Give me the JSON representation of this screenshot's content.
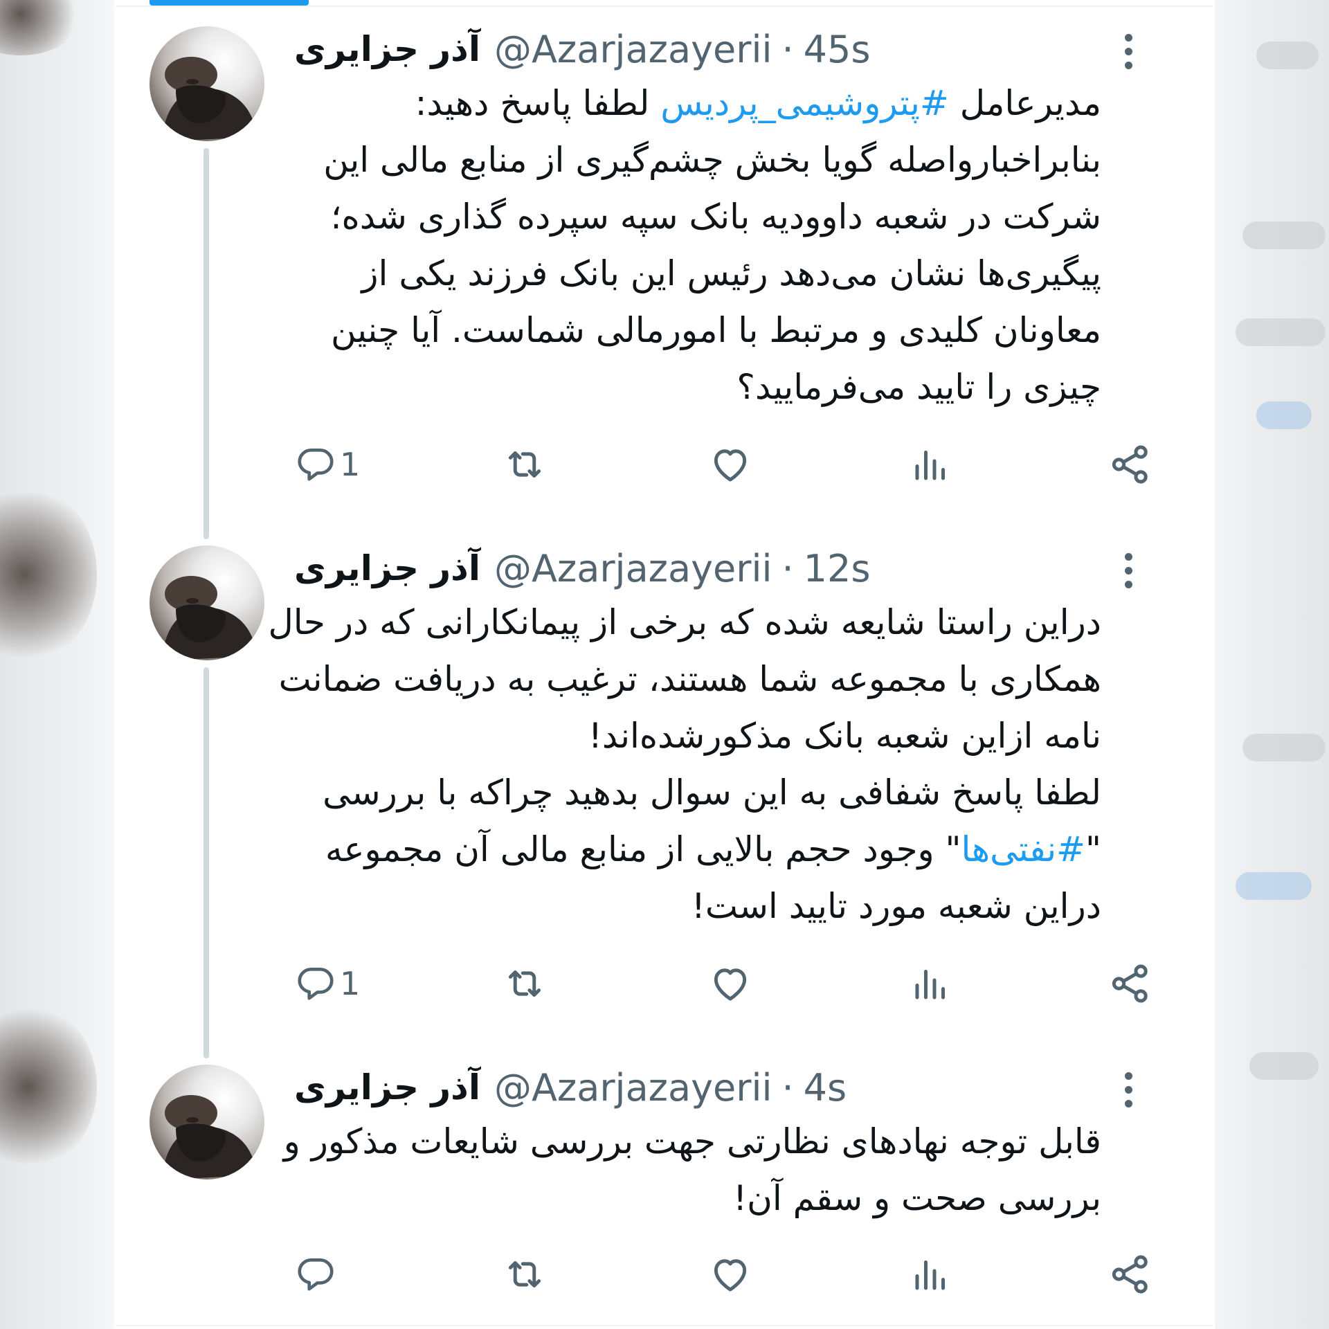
{
  "tweets": [
    {
      "name": "آذر جزایری",
      "handle": "@Azarjazayerii",
      "separator": "·",
      "time": "45s",
      "lines": [
        {
          "pre": "مدیرعامل ",
          "tag": "#پتروشیمی_پردیس",
          "post": " لطفا پاسخ دهید:"
        },
        {
          "pre": "بنابراخبارواصله گویا بخش چشم‌گیری از منابع مالی این",
          "tag": "",
          "post": ""
        },
        {
          "pre": "شرکت در شعبه داوودیه بانک سپه سپرده گذاری شده؛",
          "tag": "",
          "post": ""
        },
        {
          "pre": "پیگیری‌ها نشان می‌دهد رئیس این بانک فرزند یکی از",
          "tag": "",
          "post": ""
        },
        {
          "pre": "معاونان کلیدی و مرتبط با امورمالی شماست. آیا چنین",
          "tag": "",
          "post": ""
        },
        {
          "pre": "چیزی را تایید می‌فرمایید؟",
          "tag": "",
          "post": ""
        }
      ],
      "reply_count": "1"
    },
    {
      "name": "آذر جزایری",
      "handle": "@Azarjazayerii",
      "separator": "·",
      "time": "12s",
      "lines": [
        {
          "pre": "دراین راستا شایعه شده که برخی از پیمانکارانی که در حال",
          "tag": "",
          "post": ""
        },
        {
          "pre": "همکاری با مجموعه شما هستند، ترغیب به دریافت ضمانت",
          "tag": "",
          "post": ""
        },
        {
          "pre": "نامه ازاین شعبه بانک مذکورشده‌اند!",
          "tag": "",
          "post": ""
        },
        {
          "pre": "لطفا پاسخ شفافی به این سوال بدهید چراکه با بررسی",
          "tag": "",
          "post": ""
        },
        {
          "pre": "\"",
          "tag": "#نفتی‌ها",
          "post": "\" وجود حجم بالایی از منابع مالی آن مجموعه"
        },
        {
          "pre": "دراین شعبه مورد تایید است!",
          "tag": "",
          "post": ""
        }
      ],
      "reply_count": "1"
    },
    {
      "name": "آذر جزایری",
      "handle": "@Azarjazayerii",
      "separator": "·",
      "time": "4s",
      "lines": [
        {
          "pre": "قابل توجه نهادهای نظارتی جهت بررسی شایعات مذکور و",
          "tag": "",
          "post": ""
        },
        {
          "pre": "بررسی صحت و سقم آن!",
          "tag": "",
          "post": ""
        }
      ],
      "reply_count": ""
    }
  ],
  "icons": {
    "reply": "reply-icon",
    "retweet": "retweet-icon",
    "like": "heart-icon",
    "views": "views-icon",
    "share": "share-icon",
    "more": "more-vertical-icon"
  },
  "colors": {
    "accent": "#1d9bf0",
    "text": "#0f1419",
    "muted": "#536471",
    "thread_line": "#cfd9de"
  }
}
